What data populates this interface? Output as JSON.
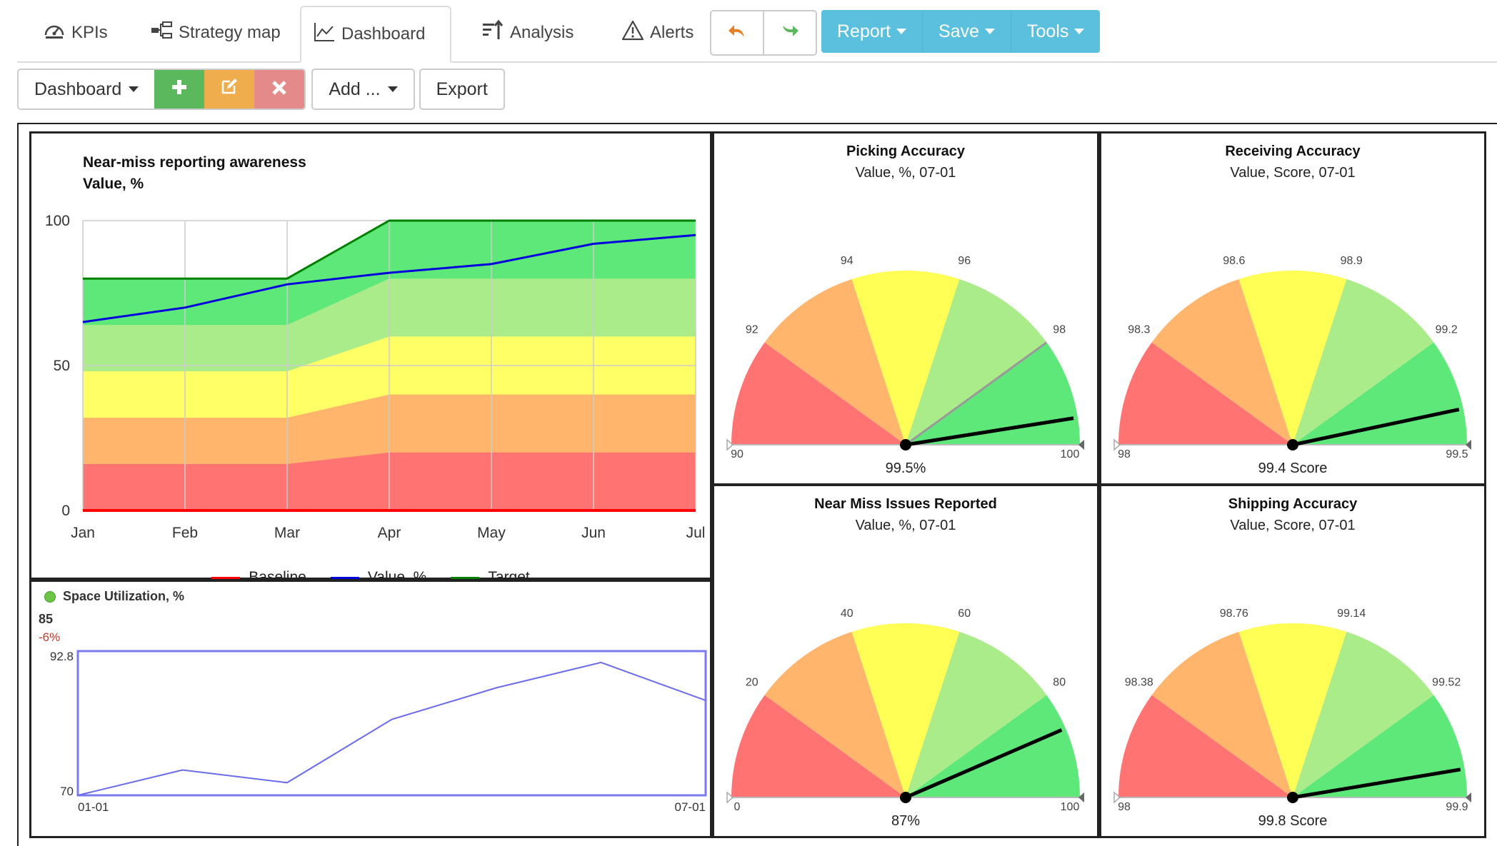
{
  "nav": {
    "tabs": [
      {
        "label": "KPIs",
        "icon": "gauge-icon"
      },
      {
        "label": "Strategy map",
        "icon": "hierarchy-icon"
      },
      {
        "label": "Dashboard",
        "icon": "line-chart-icon",
        "active": true
      },
      {
        "label": "Analysis",
        "icon": "sort-icon"
      },
      {
        "label": "Alerts",
        "icon": "warning-icon"
      }
    ],
    "undo_icon": "undo-icon",
    "redo_icon": "redo-icon",
    "menus": [
      "Report",
      "Save",
      "Tools"
    ],
    "menu_color": "#5bc0de"
  },
  "toolbar": {
    "dashboard_label": "Dashboard",
    "add_label": "Add ...",
    "export_label": "Export",
    "add_color": "#5cb85c",
    "edit_color": "#f0ad4e",
    "delete_color": "#e58a8a"
  },
  "main_chart": {
    "title": "Near-miss reporting awareness",
    "subtitle": "Value, %",
    "chart_data": {
      "type": "area",
      "categories": [
        "Jan",
        "Feb",
        "Mar",
        "Apr",
        "May",
        "Jun",
        "Jul"
      ],
      "ylim": [
        0,
        100
      ],
      "yticks": [
        "100",
        "50",
        "0"
      ],
      "series": [
        {
          "name": "Baseline",
          "color": "#ff0000",
          "values": [
            0,
            0,
            0,
            0,
            0,
            0,
            0
          ]
        },
        {
          "name": "Value, %",
          "color": "#0000dd",
          "values": [
            65,
            70,
            78,
            82,
            85,
            92,
            95
          ]
        },
        {
          "name": "Target",
          "color": "#008000",
          "values": [
            80,
            80,
            80,
            100,
            100,
            100,
            100
          ]
        }
      ],
      "bands": {
        "colors": [
          "#ff7373",
          "#ffb56b",
          "#ffff66",
          "#aaeb8a",
          "#5fe87a"
        ],
        "upper_fractions": [
          0.2,
          0.4,
          0.6,
          0.8,
          1.0
        ]
      },
      "grid": true,
      "legend_position": "bottom"
    }
  },
  "spark": {
    "title": "Space Utilization, %",
    "status_color": "#6cc644",
    "value": "85",
    "delta": "-6%",
    "chart_data": {
      "type": "line",
      "y": [
        70,
        74,
        72,
        82,
        87,
        91,
        85
      ],
      "ymin_label": "70",
      "ymax_label": "92.8",
      "xstart_label": "01-01",
      "xend_label": "07-01",
      "ylim": [
        70,
        92.8
      ]
    }
  },
  "gauges": [
    {
      "title": "Picking Accuracy",
      "subtitle": "Value, %, 07-01",
      "value_text": "99.5%",
      "ticks": [
        "90",
        "92",
        "94",
        "96",
        "98",
        "100"
      ],
      "min": 90,
      "max": 100,
      "value": 99.5,
      "target": 98
    },
    {
      "title": "Receiving Accuracy",
      "subtitle": "Value, Score, 07-01",
      "value_text": "99.4 Score",
      "ticks": [
        "98",
        "98.3",
        "98.6",
        "98.9",
        "99.2",
        "99.5"
      ],
      "min": 98,
      "max": 99.5,
      "value": 99.4
    },
    {
      "title": "Near Miss Issues Reported",
      "subtitle": "Value, %, 07-01",
      "value_text": "87%",
      "ticks": [
        "0",
        "20",
        "40",
        "60",
        "80",
        "100"
      ],
      "min": 0,
      "max": 100,
      "value": 87
    },
    {
      "title": "Shipping Accuracy",
      "subtitle": "Value, Score, 07-01",
      "value_text": "99.8 Score",
      "ticks": [
        "98",
        "98.38",
        "98.76",
        "99.14",
        "99.52",
        "99.9"
      ],
      "min": 98,
      "max": 99.9,
      "value": 99.8
    }
  ],
  "gauge_colors": [
    "#ff7373",
    "#ffb56b",
    "#ffff55",
    "#aaeb8a",
    "#5fe87a"
  ]
}
